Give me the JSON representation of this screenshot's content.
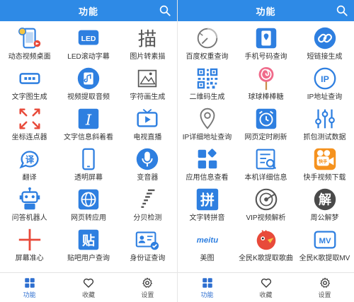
{
  "left": {
    "title": "功能",
    "items": [
      {
        "label": "动态视频桌面",
        "icon": "video-wallpaper-icon"
      },
      {
        "label": "LED滚动字幕",
        "icon": "led-icon"
      },
      {
        "label": "图片转素描",
        "icon": "sketch-icon"
      },
      {
        "label": "文字图生成",
        "icon": "text-image-icon"
      },
      {
        "label": "视频提取音频",
        "icon": "extract-audio-icon"
      },
      {
        "label": "字符画生成",
        "icon": "ascii-art-icon"
      },
      {
        "label": "坐标连点器",
        "icon": "auto-clicker-icon"
      },
      {
        "label": "文字信息斜着看",
        "icon": "italic-text-icon"
      },
      {
        "label": "电视直播",
        "icon": "tv-icon"
      },
      {
        "label": "翻译",
        "icon": "translate-icon"
      },
      {
        "label": "透明屏幕",
        "icon": "transparent-screen-icon"
      },
      {
        "label": "变音器",
        "icon": "microphone-icon"
      },
      {
        "label": "问答机器人",
        "icon": "robot-icon"
      },
      {
        "label": "网页转应用",
        "icon": "globe-icon"
      },
      {
        "label": "分贝检测",
        "icon": "decibel-icon"
      },
      {
        "label": "屏幕准心",
        "icon": "crosshair-icon"
      },
      {
        "label": "贴吧用户查询",
        "icon": "tieba-icon"
      },
      {
        "label": "身份证查询",
        "icon": "id-card-icon"
      }
    ]
  },
  "right": {
    "title": "功能",
    "items": [
      {
        "label": "百度权重查询",
        "icon": "gauge-icon"
      },
      {
        "label": "手机号码查询",
        "icon": "phone-location-icon"
      },
      {
        "label": "短链接生成",
        "icon": "link-icon"
      },
      {
        "label": "二维码生成",
        "icon": "qrcode-icon"
      },
      {
        "label": "球球棒棒糖",
        "icon": "lollipop-icon"
      },
      {
        "label": "IP地址查询",
        "icon": "ip-icon"
      },
      {
        "label": "IP详细地址查询",
        "icon": "map-pin-icon"
      },
      {
        "label": "网页定时刷新",
        "icon": "alarm-clock-icon"
      },
      {
        "label": "抓包测试数据",
        "icon": "sliders-icon"
      },
      {
        "label": "应用信息查看",
        "icon": "apps-icon"
      },
      {
        "label": "本机详细信息",
        "icon": "device-info-icon"
      },
      {
        "label": "快手视频下载",
        "icon": "kuaishou-icon"
      },
      {
        "label": "文字转拼音",
        "icon": "pinyin-icon"
      },
      {
        "label": "VIP视频解析",
        "icon": "radar-icon"
      },
      {
        "label": "周公解梦",
        "icon": "dream-icon"
      },
      {
        "label": "美图",
        "icon": "meitu-logo"
      },
      {
        "label": "全民K歌提取歌曲",
        "icon": "karaoke-bird-icon"
      },
      {
        "label": "全民K歌提取MV",
        "icon": "mv-icon"
      }
    ]
  },
  "logos": {
    "led_text": "LED",
    "sketch_char": "描",
    "italic_char": "I",
    "translate_char": "译",
    "tieba_char": "贴",
    "ip_text": "IP",
    "pinyin_char": "拼",
    "dream_char": "解",
    "meitu_text": "meitu",
    "mv_text": "MV",
    "kuaishou_text": "快手"
  },
  "tabs": [
    {
      "label": "功能",
      "icon": "grid-icon",
      "active": true
    },
    {
      "label": "收藏",
      "icon": "heart-icon",
      "active": false
    },
    {
      "label": "设置",
      "icon": "gear-icon",
      "active": false
    }
  ],
  "colors": {
    "topbar": "#2e8ae6",
    "primary": "#2e7fe0",
    "red": "#e84a3a",
    "orange": "#f5921e"
  }
}
